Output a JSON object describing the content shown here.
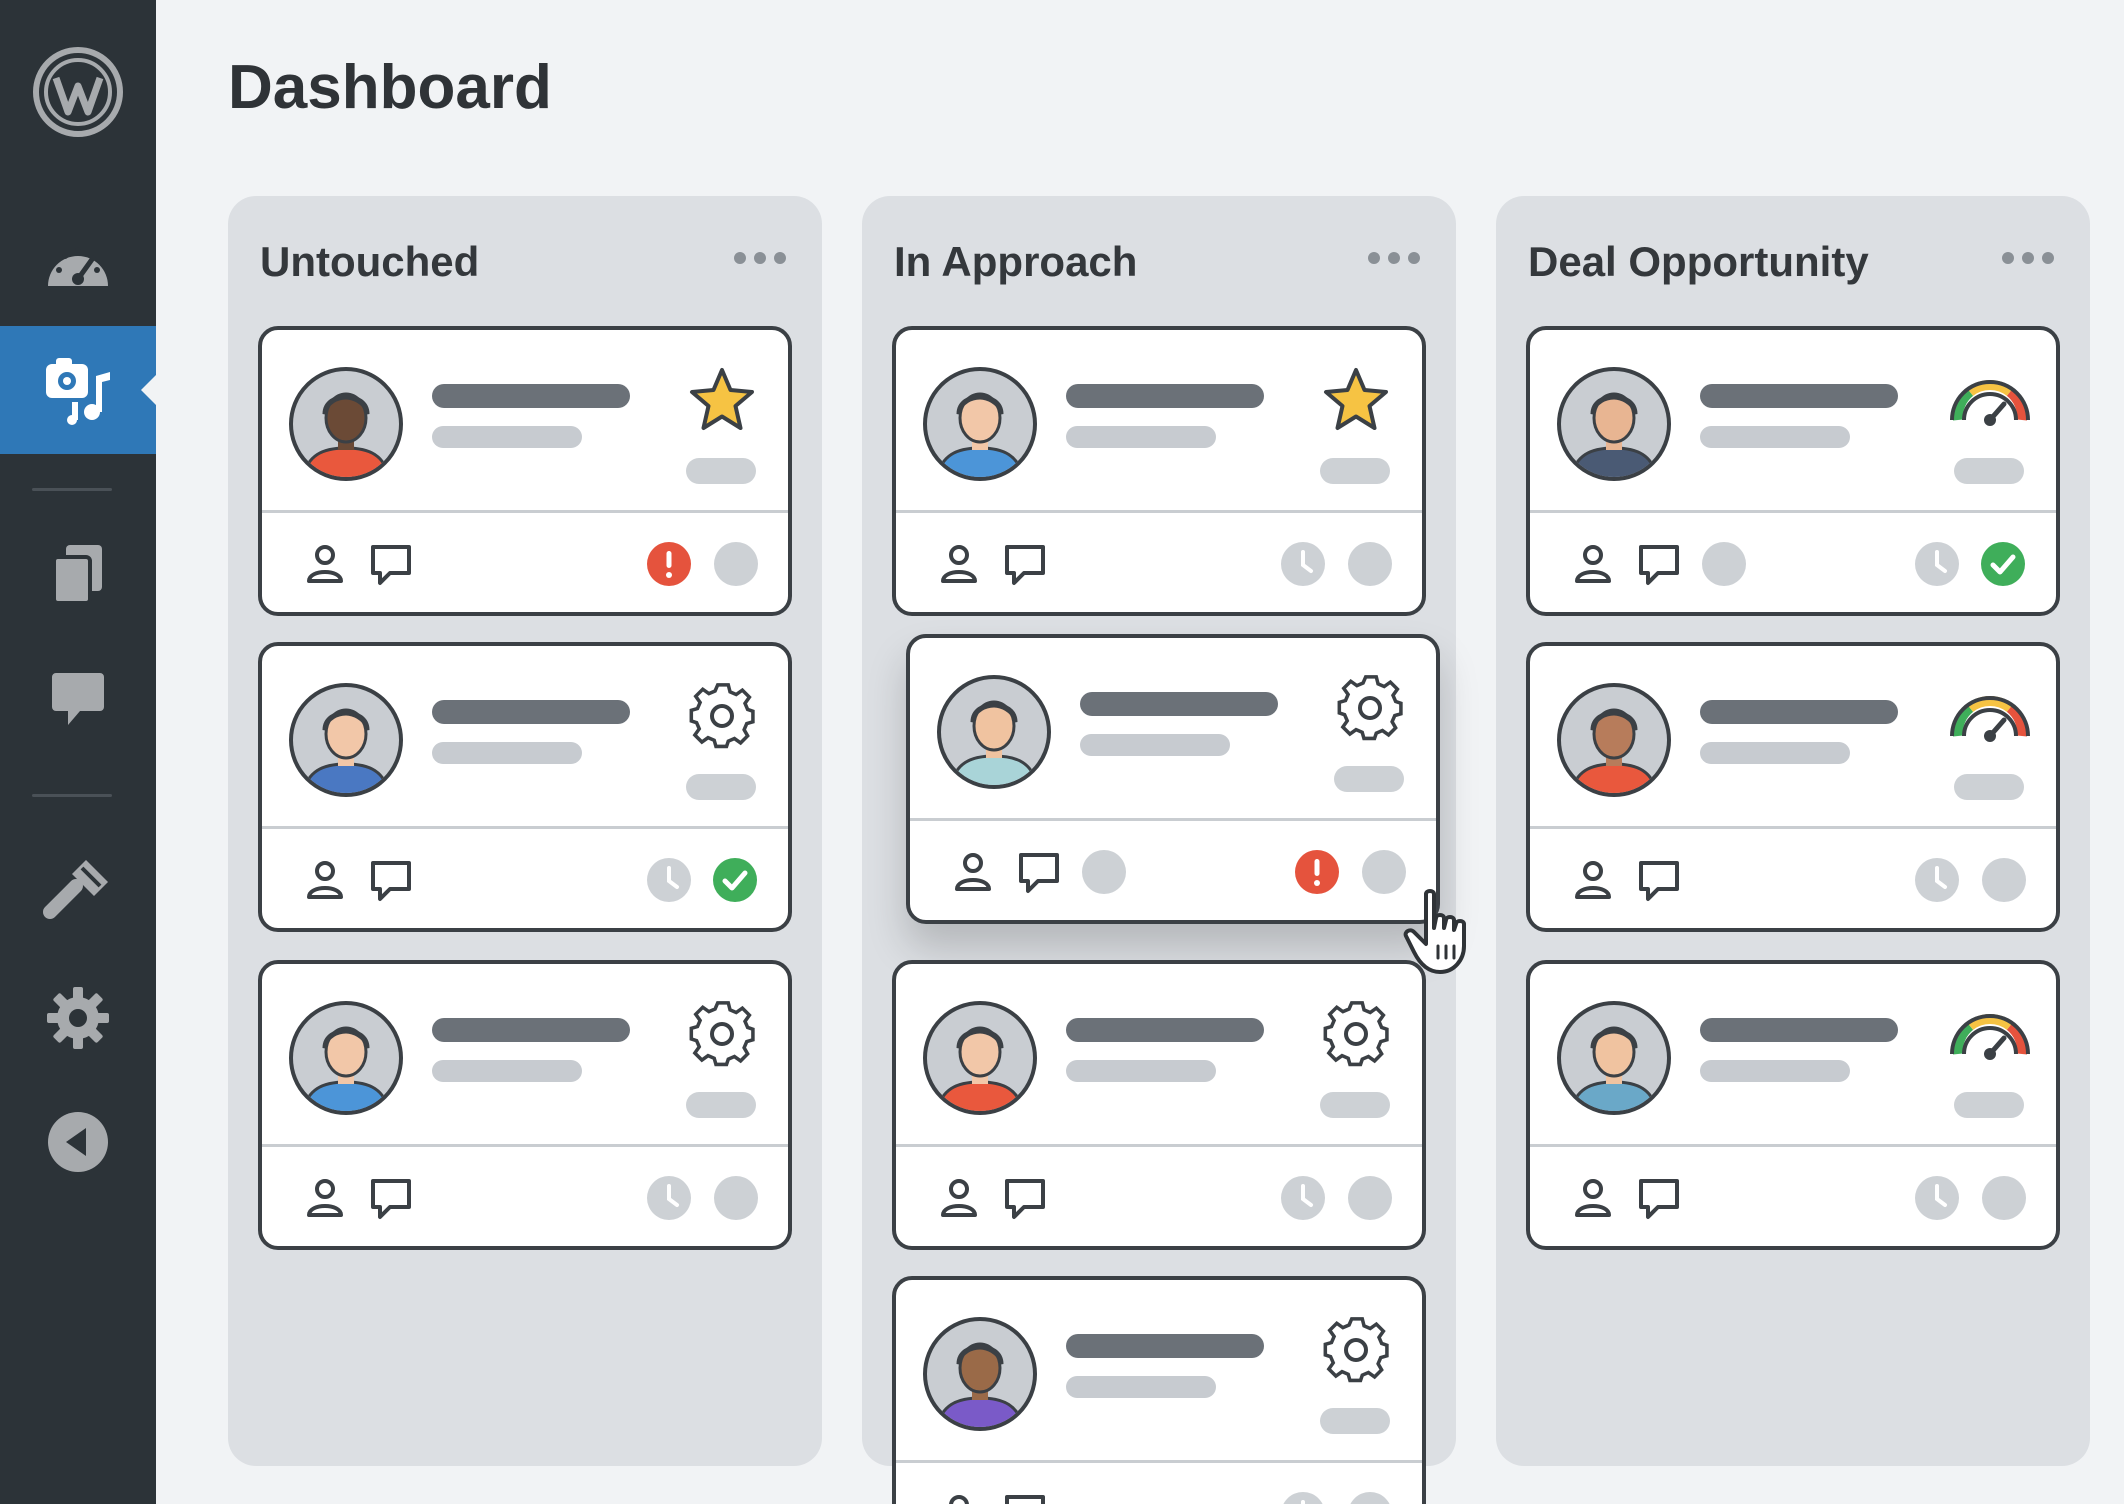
{
  "page": {
    "title": "Dashboard"
  },
  "sidebar": {
    "items": [
      {
        "icon": "wordpress-logo-icon",
        "active": false
      },
      {
        "icon": "dashboard-gauge-icon",
        "active": false
      },
      {
        "icon": "media-icon",
        "active": true
      },
      {
        "icon": "pages-icon",
        "active": false
      },
      {
        "icon": "comments-icon",
        "active": false
      },
      {
        "icon": "tools-icon",
        "active": false
      },
      {
        "icon": "settings-gear-icon",
        "active": false
      },
      {
        "icon": "collapse-menu-icon",
        "active": false
      }
    ]
  },
  "columns": [
    {
      "title": "Untouched",
      "cards": [
        {
          "badge": "star-icon",
          "status": [
            "alert-icon",
            "empty-circle"
          ]
        },
        {
          "badge": "gear-icon",
          "status": [
            "clock-icon",
            "check-icon"
          ]
        },
        {
          "badge": "gear-icon",
          "status": [
            "clock-icon",
            "empty-circle"
          ]
        }
      ]
    },
    {
      "title": "In Approach",
      "cards": [
        {
          "badge": "star-icon",
          "status": [
            "clock-icon",
            "empty-circle"
          ]
        },
        {
          "badge": "gear-icon",
          "status": [
            "alert-icon",
            "empty-circle"
          ],
          "dragging": true
        },
        {
          "badge": "gear-icon",
          "status": [
            "clock-icon",
            "empty-circle"
          ]
        },
        {
          "badge": "gear-icon",
          "status": [
            "clock-icon",
            "empty-circle"
          ]
        }
      ]
    },
    {
      "title": "Deal Opportunity",
      "cards": [
        {
          "badge": "gauge-icon",
          "status": [
            "clock-icon",
            "check-icon"
          ]
        },
        {
          "badge": "gauge-icon",
          "status": [
            "clock-icon",
            "empty-circle"
          ]
        },
        {
          "badge": "gauge-icon",
          "status": [
            "clock-icon",
            "empty-circle"
          ]
        }
      ]
    }
  ],
  "colors": {
    "sidebar_bg": "#2c3338",
    "sidebar_active": "#2f78b7",
    "alert": "#e5533d",
    "success": "#3fae5a",
    "star": "#f6c343"
  }
}
